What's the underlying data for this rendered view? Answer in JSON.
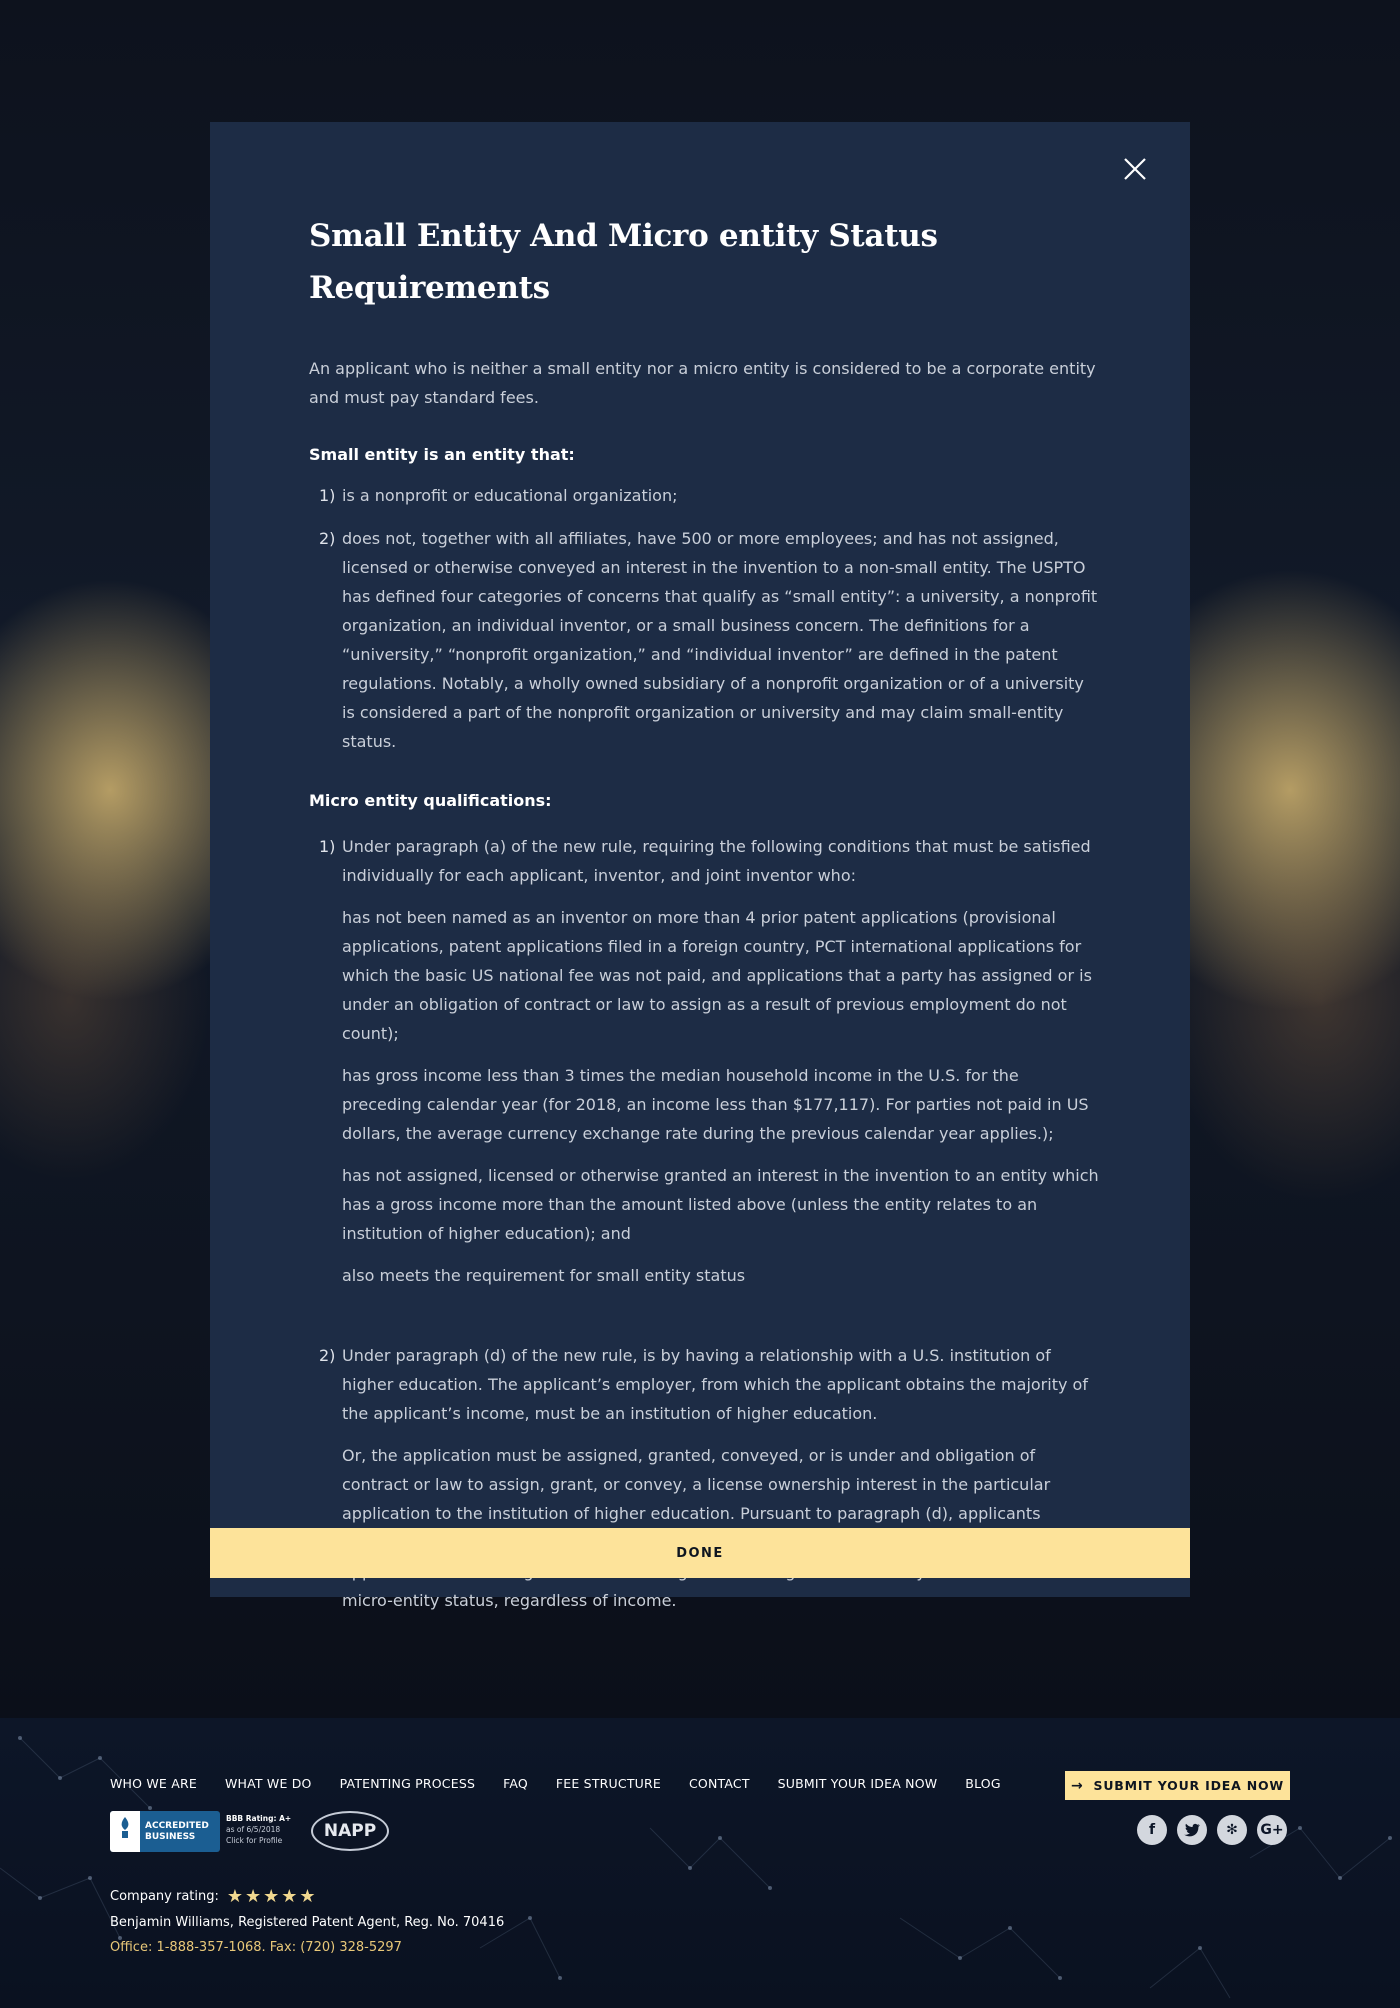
{
  "modal": {
    "title": "Small Entity And Micro entity Status Requirements",
    "intro": "An applicant who is neither a small entity nor a micro entity is considered to be a corporate entity and must pay standard fees.",
    "small_entity": {
      "heading": "Small entity is an entity that:",
      "items": [
        {
          "num": "1)",
          "text": "is a nonprofit or educational organization;"
        },
        {
          "num": "2)",
          "text": "does not, together with all affiliates, have 500 or more employees; and has not assigned, licensed or otherwise conveyed an interest in the invention to a non-small entity. The USPTO has defined four categories of concerns that qualify as “small entity”: a university, a nonprofit organization, an individual inventor, or a small business concern. The definitions for a “university,” “nonprofit organization,” and “individual inventor” are defined in the patent regulations. Notably, a wholly owned subsidiary of a nonprofit organization or of a university is considered a part of the nonprofit organization or university and may claim small-entity status."
        }
      ]
    },
    "micro_entity": {
      "heading": "Micro entity qualifications:",
      "item1": {
        "num": "1)",
        "text": "Under paragraph (a) of the new rule, requiring the following conditions that must be satisfied individually for each applicant, inventor, and joint inventor who:",
        "conditions": [
          "has not been named as an inventor on more than 4 prior patent applications (provisional applications, patent applications filed in a foreign country, PCT international applications for which the basic US national fee was not paid, and applications that a party has assigned or is under an obligation of contract or law to assign as a result of previous employment do not count);",
          "has gross income less than 3 times the median household income in the U.S. for the preceding calendar year (for 2018, an income less than $177,117). For parties not paid in US dollars, the average currency exchange rate during the previous calendar year applies.);",
          "has not assigned, licensed or otherwise granted an interest in the invention to an entity which has a gross income more than the amount listed above (unless the entity relates to an institution of higher education); and",
          "also meets the requirement for small entity status"
        ]
      },
      "item2": {
        "num": "2)",
        "text": "Under paragraph (d) of the new rule, is by having a relationship with a U.S. institution of higher education. The applicant’s employer, from which the applicant obtains the majority of the applicant’s income, must be an institution of higher education.",
        "extra": "Or, the application must be assigned, granted, conveyed, or is under and obligation of contract or law to assign, grant, or convey, a license ownership interest in the particular application to the institution of higher education. Pursuant to paragraph (d), applicants employed by the university who derive a majority of their income from the university, or an applicant who has assigned or has an obligation to assign to a university can also claim micro-entity status, regardless of income."
      }
    },
    "done_label": "DONE",
    "close_icon": "close-icon"
  },
  "footer": {
    "nav": [
      "WHO WE ARE",
      "WHAT WE DO",
      "PATENTING PROCESS",
      "FAQ",
      "FEE STRUCTURE",
      "CONTACT",
      "SUBMIT YOUR IDEA NOW",
      "BLOG"
    ],
    "submit_label": "SUBMIT YOUR IDEA NOW",
    "bbb": {
      "logo_text": "BBB",
      "accredited": "ACCREDITED",
      "business": "BUSINESS",
      "rating": "BBB Rating: A+",
      "as_of": "as of 6/5/2018",
      "click": "Click for Profile"
    },
    "napp": "NAPP",
    "social_icons": [
      "facebook-icon",
      "twitter-icon",
      "yelp-icon",
      "google-plus-icon"
    ],
    "rating_label": "Company rating:",
    "rating_stars": 5,
    "agent": "Benjamin Williams, Registered Patent Agent, Reg. No. 70416",
    "office": "Office: 1-888-357-1068. Fax: (720) 328-5297"
  },
  "colors": {
    "modal_bg": "#1d2c45",
    "accent": "#fde39a",
    "footer_bg": "#0d1628",
    "office_text": "#e9c879"
  }
}
